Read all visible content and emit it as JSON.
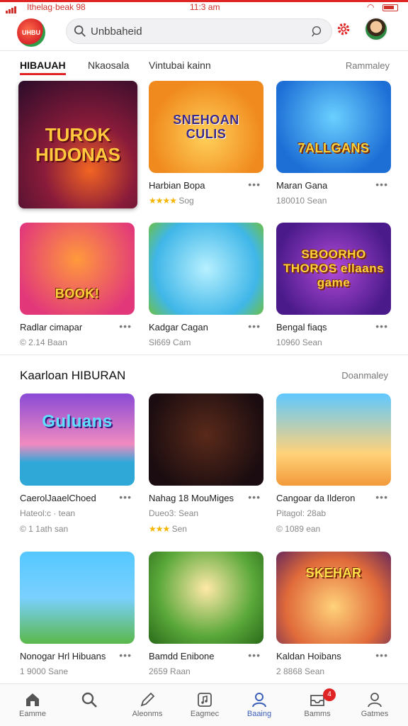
{
  "status_bar": {
    "carrier": "Ithelag·beak 98",
    "time": "11:3 am"
  },
  "header": {
    "logo_text": "UHBU",
    "search_text": "Unbbaheid"
  },
  "tabs": [
    "HIBAUAH",
    "Nkaosala",
    "Vintubai kainn"
  ],
  "tabs_see_all": "Rammaley",
  "featured": {
    "title": "TUROK HIDONAS"
  },
  "row1": [
    {
      "thumb_title": "SNEHOAN CULIS",
      "name": "Harbian Bopa",
      "stars": "★★★★",
      "meta": "Sog"
    },
    {
      "thumb_title": "7ALLGANS",
      "name": "Maran Gana",
      "meta": "180010 Sean"
    }
  ],
  "row2": [
    {
      "thumb_title": "BOOK!",
      "name": "Radlar cimapar",
      "meta": "© 2.14 Baan"
    },
    {
      "thumb_title": "",
      "name": "Kadgar Cagan",
      "meta": "Sl669 Cam"
    },
    {
      "thumb_title": "SBOORHO THOROS ellaans game",
      "name": "Bengal fiaqs",
      "meta": "10960 Sean"
    }
  ],
  "section": {
    "title": "Kaarloan HIBURAN",
    "see_all": "Doanmaley"
  },
  "row3": [
    {
      "thumb_title": "Guluans",
      "name": "CaerolJaaelChoed",
      "sub": "Hateol:c · tean",
      "meta": "© 1 1ath san"
    },
    {
      "thumb_title": "",
      "name": "Nahag 18 MouMiges",
      "sub": "Dueo3: Sean",
      "stars": "★★★",
      "meta": "Sen"
    },
    {
      "thumb_title": "",
      "name": "Cangoar da Ilderon",
      "sub": "Pitagol: 28ab",
      "meta": "© 1089 ean"
    }
  ],
  "row4": [
    {
      "thumb_title": "",
      "name": "Nonogar Hrl Hibuans",
      "meta": "1 9000 Sane"
    },
    {
      "thumb_title": "",
      "name": "Bamdd Enibone",
      "meta": "2659 Raan"
    },
    {
      "thumb_title": "SKEHAR",
      "name": "Kaldan Hoibans",
      "meta": "2 8868 Sean"
    }
  ],
  "nav": {
    "items": [
      {
        "label": "Eamme",
        "icon": "home-icon"
      },
      {
        "label": "",
        "icon": "search-icon"
      },
      {
        "label": "Aleonms",
        "icon": "pen-icon"
      },
      {
        "label": "Eagmec",
        "icon": "music-icon"
      },
      {
        "label": "Baaing",
        "icon": "user-icon"
      },
      {
        "label": "Bamms",
        "icon": "inbox-icon",
        "badge": "4"
      },
      {
        "label": "Gatmes",
        "icon": "profile-icon"
      }
    ]
  },
  "colors": {
    "accent": "#e02424",
    "active_nav": "#3b5fb8"
  }
}
